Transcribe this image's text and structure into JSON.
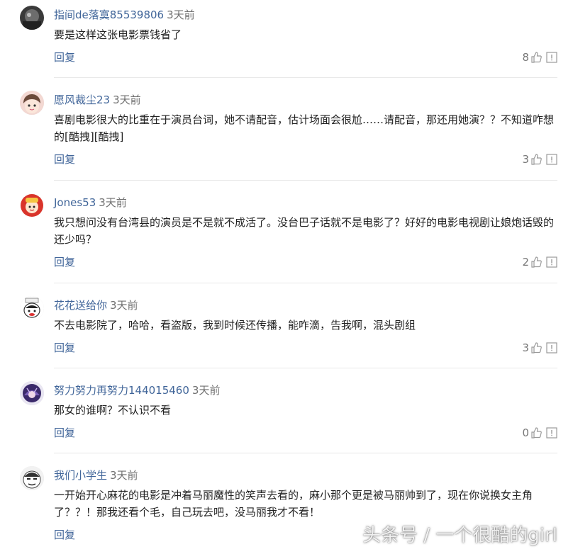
{
  "comments": [
    {
      "username": "指间de落寞85539806",
      "time": "3天前",
      "text": "要是这样这张电影票钱省了",
      "reply_label": "回复",
      "likes": "8"
    },
    {
      "username": "愿风裁尘23",
      "time": "3天前",
      "text": "喜剧电影很大的比重在于演员台词，她不请配音，估计场面会很尬……请配音，那还用她演？？不知道咋想的[酷拽][酷拽]",
      "reply_label": "回复",
      "likes": "3"
    },
    {
      "username": "Jones53",
      "time": "3天前",
      "text": "我只想问没有台湾县的演员是不是就不成活了。没台巴子话就不是电影了？好好的电影电视剧让娘炮话毁的还少吗？",
      "reply_label": "回复",
      "likes": "2"
    },
    {
      "username": "花花送给你",
      "time": "3天前",
      "text": "不去电影院了，哈哈，看盗版，我到时候还传播，能咋滴，告我啊，混头剧组",
      "reply_label": "回复",
      "likes": "3"
    },
    {
      "username": "努力努力再努力144015460",
      "time": "3天前",
      "text": "那女的谁啊？不认识不看",
      "reply_label": "回复",
      "likes": "0"
    },
    {
      "username": "我们小学生",
      "time": "3天前",
      "text": "一开始开心麻花的电影是冲着马丽魔性的笑声去看的，麻小那个更是被马丽帅到了，现在你说换女主角了？？！那我还看个毛，自己玩去吧，没马丽我才不看！",
      "reply_label": "回复",
      "likes": ""
    }
  ],
  "watermark": "头条号 / 一个很酷的girl",
  "colors": {
    "username": "#406599",
    "reply": "#406599",
    "divider": "#e8e8e8"
  },
  "icons": {
    "like": "thumbs-up-icon",
    "report": "report-flag-icon"
  }
}
